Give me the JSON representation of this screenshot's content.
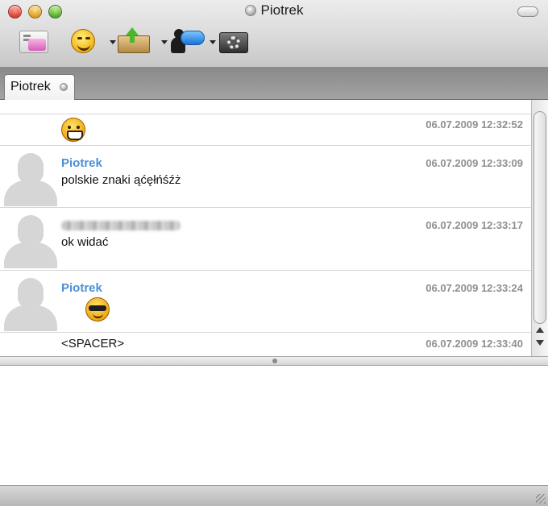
{
  "window": {
    "title": "Piotrek",
    "status_icon": "status-dot-icon"
  },
  "toolbar": {
    "buttons": [
      {
        "icon": "contact-card-icon"
      },
      {
        "icon": "emoticon-icon"
      },
      {
        "icon": "send-file-icon"
      },
      {
        "icon": "contact-info-icon"
      },
      {
        "icon": "settings-icon"
      }
    ]
  },
  "tabs": [
    {
      "label": "Piotrek"
    }
  ],
  "messages": [
    {
      "sender": "",
      "text": "",
      "timestamp": "06.07.2009 12:32:52",
      "emoticon": "grin-icon"
    },
    {
      "sender": "Piotrek",
      "text": "polskie znaki ąćęłńśźż",
      "timestamp": "06.07.2009 12:33:09"
    },
    {
      "sender": "",
      "text": "ok widać",
      "timestamp": "06.07.2009 12:33:17"
    },
    {
      "sender": "Piotrek",
      "text": "",
      "timestamp": "06.07.2009 12:33:24",
      "emoticon": "cool-icon"
    },
    {
      "sender": "",
      "text": "<SPACER>",
      "timestamp": "06.07.2009 12:33:40"
    }
  ],
  "input": {
    "value": ""
  },
  "colors": {
    "sender_name": "#4a90d6",
    "timestamp": "#8f8f8f",
    "chrome_top": "#ececec",
    "tabstrip": "#8a8a8a"
  }
}
